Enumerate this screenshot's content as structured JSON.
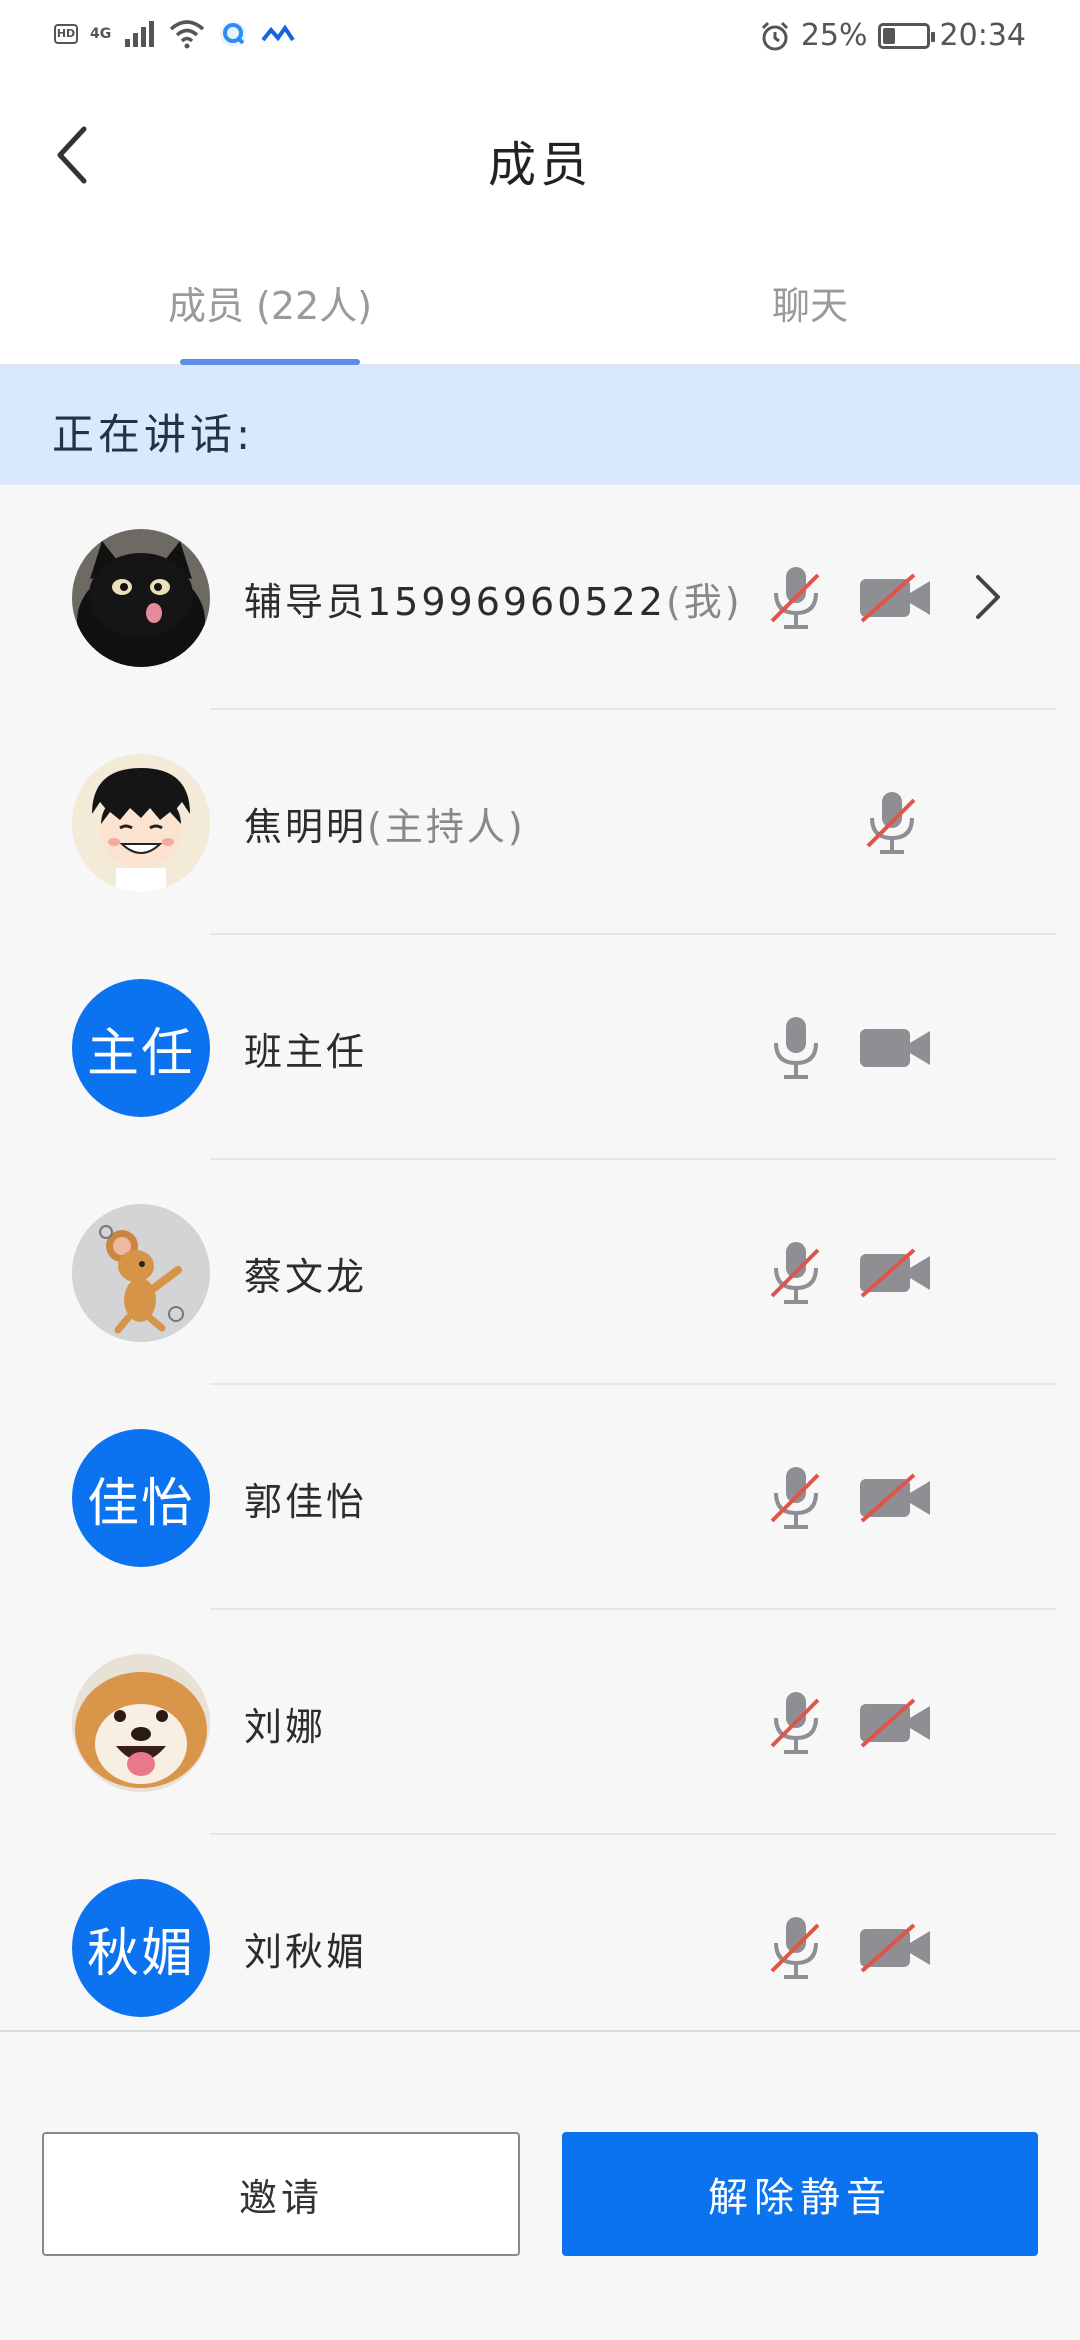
{
  "status_bar": {
    "hd_badge": "HD",
    "network_type": "4G",
    "battery_percent": "25%",
    "time": "20:34"
  },
  "header": {
    "title": "成员"
  },
  "tabs": [
    {
      "label": "成员 (22人)",
      "active": true
    },
    {
      "label": "聊天",
      "active": false
    }
  ],
  "speaking": {
    "label": "正在讲话:"
  },
  "members": [
    {
      "name": "辅导员15996960522",
      "suffix": "(我)",
      "avatar_type": "image",
      "avatar_desc": "black-cat",
      "mic": "muted",
      "camera": "off",
      "has_detail": true
    },
    {
      "name": "焦明明",
      "suffix": "(主持人)",
      "avatar_type": "image",
      "avatar_desc": "cartoon-boy",
      "mic": "muted",
      "camera": "none",
      "has_detail": false
    },
    {
      "name": "班主任",
      "suffix": "",
      "avatar_type": "text",
      "avatar_text": "主任",
      "mic": "on",
      "camera": "on",
      "has_detail": false
    },
    {
      "name": "蔡文龙",
      "suffix": "",
      "avatar_type": "image",
      "avatar_desc": "cartoon-mouse",
      "mic": "muted",
      "camera": "off",
      "has_detail": false
    },
    {
      "name": "郭佳怡",
      "suffix": "",
      "avatar_type": "text",
      "avatar_text": "佳怡",
      "mic": "muted",
      "camera": "off",
      "has_detail": false
    },
    {
      "name": "刘娜",
      "suffix": "",
      "avatar_type": "image",
      "avatar_desc": "shiba-dog",
      "mic": "muted",
      "camera": "off",
      "has_detail": false
    },
    {
      "name": "刘秋媚",
      "suffix": "",
      "avatar_type": "text",
      "avatar_text": "秋媚",
      "mic": "muted",
      "camera": "off",
      "has_detail": false
    }
  ],
  "actions": {
    "invite_label": "邀请",
    "unmute_label": "解除静音"
  },
  "colors": {
    "accent": "#0b72f0",
    "banner": "#d9e8fc",
    "muted_slash": "#e0554b",
    "icon_gray": "#8e8e93"
  }
}
